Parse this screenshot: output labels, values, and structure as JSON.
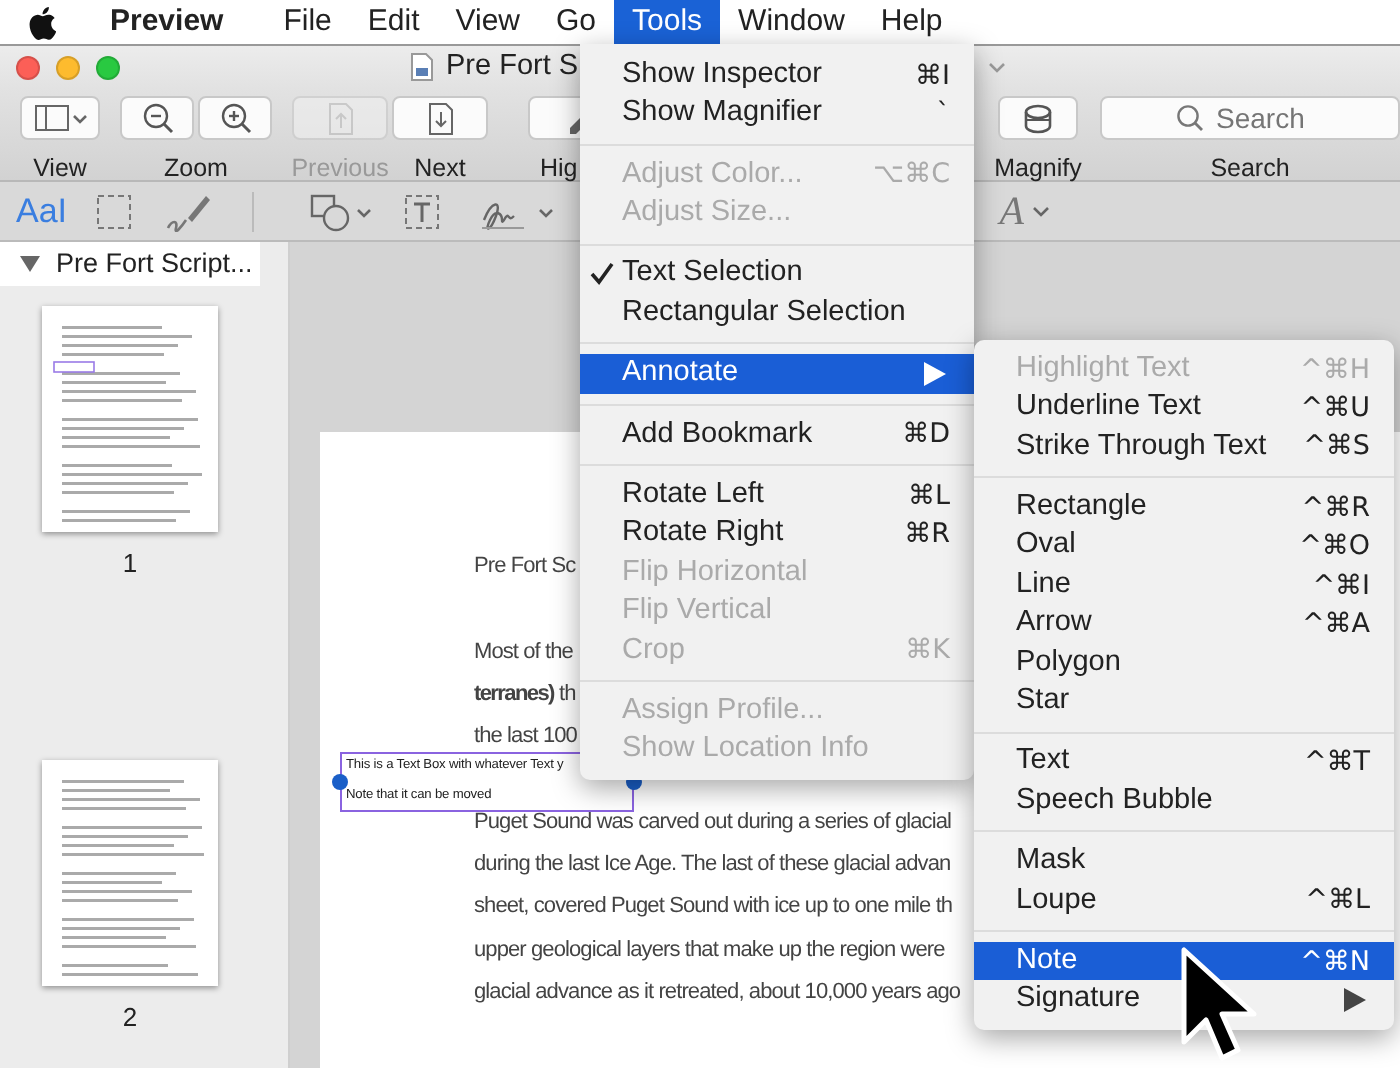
{
  "menu_bar": {
    "items": [
      {
        "label": "Preview",
        "kind": "app",
        "selected": false
      },
      {
        "label": "File",
        "kind": "menu",
        "selected": false
      },
      {
        "label": "Edit",
        "kind": "menu",
        "selected": false
      },
      {
        "label": "View",
        "kind": "menu",
        "selected": false
      },
      {
        "label": "Go",
        "kind": "menu",
        "selected": false
      },
      {
        "label": "Tools",
        "kind": "menu",
        "selected": true
      },
      {
        "label": "Window",
        "kind": "menu",
        "selected": false
      },
      {
        "label": "Help",
        "kind": "menu",
        "selected": false
      }
    ]
  },
  "window": {
    "title": "Pre Fort S"
  },
  "toolbar": {
    "items": [
      {
        "kind": "view",
        "label": "View",
        "disabled": false
      },
      {
        "kind": "zoom",
        "label": "Zoom",
        "disabled": false
      },
      {
        "kind": "previous",
        "label": "Previous",
        "disabled": true
      },
      {
        "kind": "next",
        "label": "Next",
        "disabled": false
      },
      {
        "kind": "highlight",
        "label": "Hig",
        "disabled": false
      },
      {
        "kind": "magnify",
        "label": "Magnify",
        "disabled": false
      },
      {
        "kind": "search",
        "label": "Search",
        "placeholder": "Search",
        "disabled": false
      }
    ]
  },
  "markup_tools": [
    {
      "kind": "text-select",
      "label": "AaI",
      "selected": true
    },
    {
      "kind": "rect-select",
      "selected": false
    },
    {
      "kind": "sketch",
      "selected": false
    },
    {
      "kind": "shapes",
      "selected": false
    },
    {
      "kind": "textbox",
      "selected": false
    },
    {
      "kind": "sign",
      "selected": false
    },
    {
      "kind": "font",
      "label": "A",
      "selected": false
    }
  ],
  "sidebar": {
    "title": "Pre Fort Script...",
    "expanded": true,
    "thumbnails": [
      {
        "label": "1"
      },
      {
        "label": "2"
      }
    ]
  },
  "document": {
    "paragraphs": [
      {
        "lines": [
          "Pre Fort Sc"
        ]
      },
      {
        "lines": [
          "Most of the",
          "**terranes)** th",
          "the last 100"
        ]
      },
      {
        "lines": [
          "Puget Sound was carved out during a series of glacial",
          "during the last Ice Age.  The last of these glacial advan",
          "sheet, covered Puget Sound with ice up to one mile th",
          "upper geological layers that make up the region were",
          "glacial advance as it retreated, about 10,000 years ago"
        ]
      }
    ],
    "text_box": {
      "lines": [
        "This is a Text Box with whatever Text y",
        "Note that it can be moved"
      ]
    }
  },
  "tools_menu": {
    "sections": [
      {
        "items": [
          {
            "label": "Show Inspector",
            "shortcut": "⌘I",
            "disabled": false,
            "checked": false,
            "selected": false,
            "submenu": false
          },
          {
            "label": "Show Magnifier",
            "shortcut": "`",
            "disabled": false,
            "checked": false,
            "selected": false,
            "submenu": false
          }
        ]
      },
      {
        "items": [
          {
            "label": "Adjust Color...",
            "shortcut": "⌥⌘C",
            "disabled": true,
            "checked": false,
            "selected": false,
            "submenu": false
          },
          {
            "label": "Adjust Size...",
            "disabled": true,
            "checked": false,
            "selected": false,
            "submenu": false
          }
        ]
      },
      {
        "items": [
          {
            "label": "Text Selection",
            "disabled": false,
            "checked": true,
            "selected": false,
            "submenu": false
          },
          {
            "label": "Rectangular Selection",
            "disabled": false,
            "checked": false,
            "selected": false,
            "submenu": false
          }
        ]
      },
      {
        "items": [
          {
            "label": "Annotate",
            "disabled": false,
            "checked": false,
            "selected": true,
            "submenu": true
          }
        ]
      },
      {
        "items": [
          {
            "label": "Add Bookmark",
            "shortcut": "⌘D",
            "disabled": false,
            "checked": false,
            "selected": false,
            "submenu": false
          }
        ]
      },
      {
        "items": [
          {
            "label": "Rotate Left",
            "shortcut": "⌘L",
            "disabled": false,
            "checked": false,
            "selected": false,
            "submenu": false
          },
          {
            "label": "Rotate Right",
            "shortcut": "⌘R",
            "disabled": false,
            "checked": false,
            "selected": false,
            "submenu": false
          },
          {
            "label": "Flip Horizontal",
            "disabled": true,
            "checked": false,
            "selected": false,
            "submenu": false
          },
          {
            "label": "Flip Vertical",
            "disabled": true,
            "checked": false,
            "selected": false,
            "submenu": false
          },
          {
            "label": "Crop",
            "shortcut": "⌘K",
            "disabled": true,
            "checked": false,
            "selected": false,
            "submenu": false
          }
        ]
      },
      {
        "items": [
          {
            "label": "Assign Profile...",
            "disabled": true,
            "checked": false,
            "selected": false,
            "submenu": false
          },
          {
            "label": "Show Location Info",
            "disabled": true,
            "checked": false,
            "selected": false,
            "submenu": false
          }
        ]
      }
    ]
  },
  "annotate_menu": {
    "sections": [
      {
        "items": [
          {
            "label": "Highlight Text",
            "shortcut": "^⌘H",
            "disabled": true,
            "selected": false,
            "submenu": false
          },
          {
            "label": "Underline Text",
            "shortcut": "^⌘U",
            "disabled": false,
            "selected": false,
            "submenu": false
          },
          {
            "label": "Strike Through Text",
            "shortcut": "^⌘S",
            "disabled": false,
            "selected": false,
            "submenu": false
          }
        ]
      },
      {
        "items": [
          {
            "label": "Rectangle",
            "shortcut": "^⌘R",
            "disabled": false,
            "selected": false,
            "submenu": false
          },
          {
            "label": "Oval",
            "shortcut": "^⌘O",
            "disabled": false,
            "selected": false,
            "submenu": false
          },
          {
            "label": "Line",
            "shortcut": "^⌘I",
            "disabled": false,
            "selected": false,
            "submenu": false
          },
          {
            "label": "Arrow",
            "shortcut": "^⌘A",
            "disabled": false,
            "selected": false,
            "submenu": false
          },
          {
            "label": "Polygon",
            "disabled": false,
            "selected": false,
            "submenu": false
          },
          {
            "label": "Star",
            "disabled": false,
            "selected": false,
            "submenu": false
          }
        ]
      },
      {
        "items": [
          {
            "label": "Text",
            "shortcut": "^⌘T",
            "disabled": false,
            "selected": false,
            "submenu": false
          },
          {
            "label": "Speech Bubble",
            "disabled": false,
            "selected": false,
            "submenu": false
          }
        ]
      },
      {
        "items": [
          {
            "label": "Mask",
            "disabled": false,
            "selected": false,
            "submenu": false
          },
          {
            "label": "Loupe",
            "shortcut": "^⌘L",
            "disabled": false,
            "selected": false,
            "submenu": false
          }
        ]
      },
      {
        "items": [
          {
            "label": "Note",
            "shortcut": "^⌘N",
            "disabled": false,
            "selected": true,
            "submenu": false
          },
          {
            "label": "Signature",
            "disabled": false,
            "selected": false,
            "submenu": true
          }
        ]
      }
    ]
  }
}
